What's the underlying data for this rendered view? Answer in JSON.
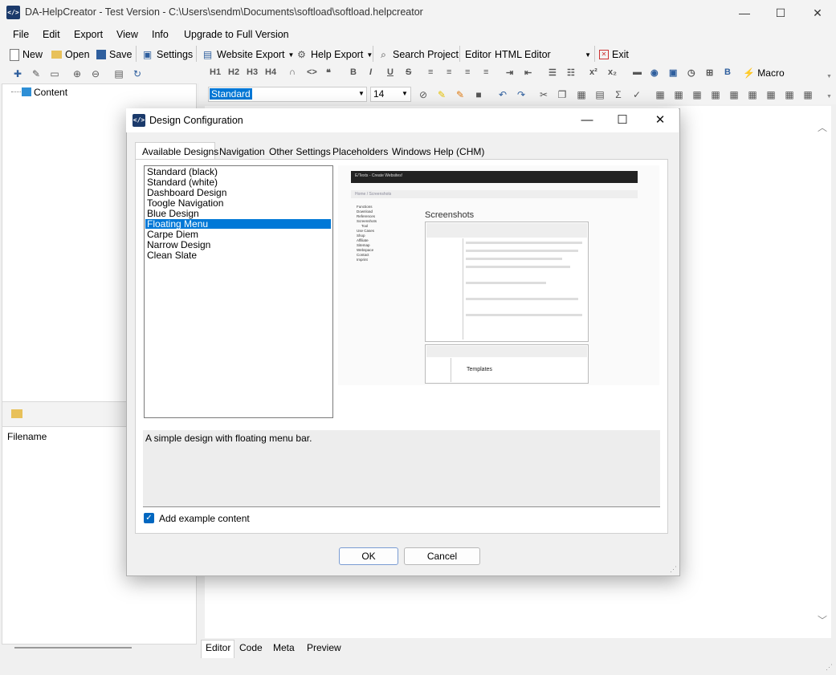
{
  "window": {
    "title": "DA-HelpCreator - Test Version - C:\\Users\\sendm\\Documents\\softload\\softload.helpcreator",
    "icon_text": "</>",
    "minimize": "—",
    "maximize": "☐",
    "close": "✕"
  },
  "menu": [
    "File",
    "Edit",
    "Export",
    "View",
    "Info",
    "Upgrade to Full Version"
  ],
  "toolbar": {
    "new": "New",
    "open": "Open",
    "save": "Save",
    "settings": "Settings",
    "website_export": "Website Export",
    "help_export": "Help Export",
    "search_project": "Search Project",
    "editor_label": "Editor",
    "editor_value": "HTML Editor",
    "exit": "Exit"
  },
  "format_toolbar": {
    "headings": [
      "H1",
      "H2",
      "H3",
      "H4"
    ],
    "macro": "Macro",
    "style_value": "Standard",
    "size_value": "14"
  },
  "tree": {
    "root": "Content"
  },
  "files": {
    "column": "Filename"
  },
  "editor_tabs": [
    "Editor",
    "Code",
    "Meta",
    "Preview"
  ],
  "dialog": {
    "title": "Design Configuration",
    "tabs": [
      "Available Designs",
      "Navigation",
      "Other Settings",
      "Placeholders",
      "Windows Help (CHM)"
    ],
    "designs": [
      "Standard (black)",
      "Standard (white)",
      "Dashboard Design",
      "Toogle Navigation",
      "Blue Design",
      "Floating Menu",
      "Carpe Diem",
      "Narrow Design",
      "Clean Slate"
    ],
    "selected_design": "Floating Menu",
    "description": "A simple design with floating menu bar.",
    "add_example_label": "Add example content",
    "add_example_checked": true,
    "ok": "OK",
    "cancel": "Cancel",
    "preview": {
      "header": "E/Texts - Create Websites!",
      "breadcrumb": "Home  /  Screenshots",
      "nav": [
        "Functions",
        "Download",
        "References",
        "Screenshots",
        "Tool",
        "Use Cases",
        "Shop",
        "Affiliate",
        "Sitemap",
        "Webspace",
        "Contact",
        "Imprint"
      ],
      "heading": "Screenshots",
      "subheading": "Templates"
    }
  },
  "colors": {
    "accent": "#0078d7",
    "checkbox": "#0067c0"
  }
}
